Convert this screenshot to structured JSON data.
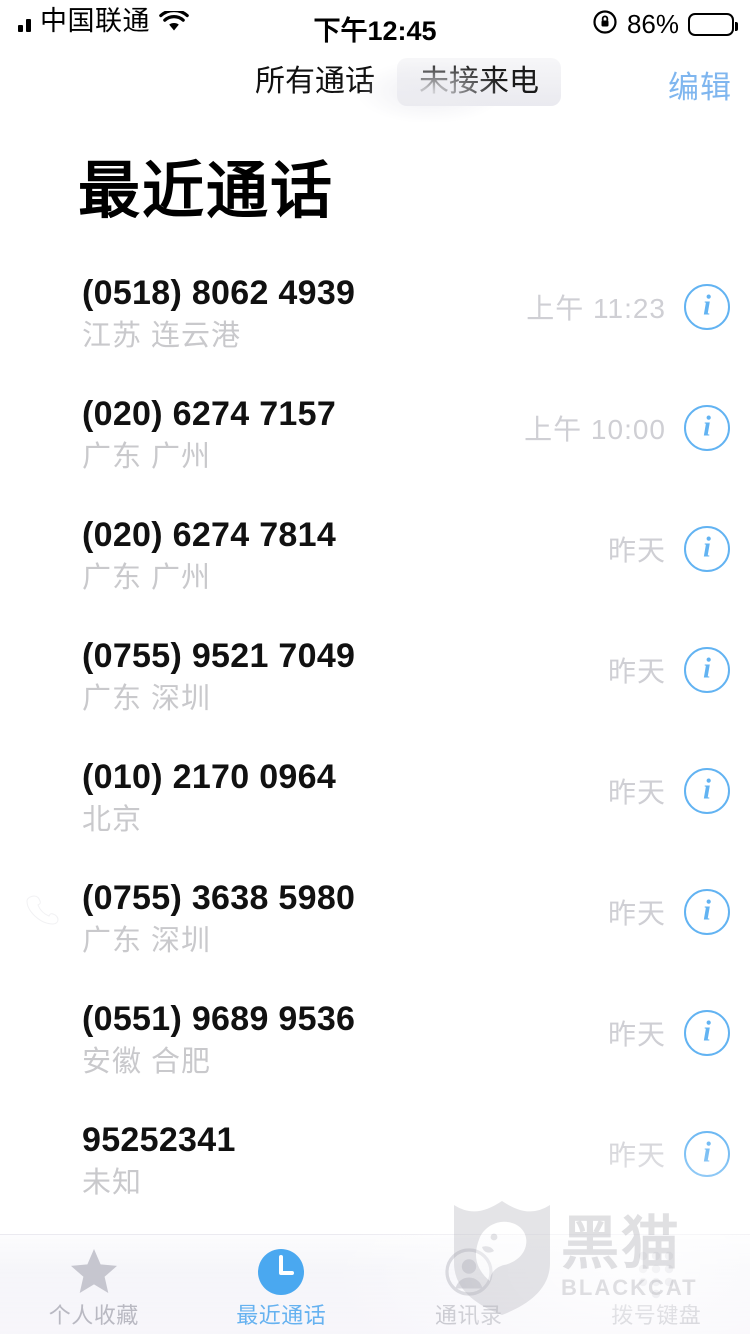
{
  "status_bar": {
    "carrier": "中国联通",
    "signal_icon": "signal-bars-icon",
    "wifi_icon": "wifi-icon",
    "time": "下午12:45",
    "rotation_lock_icon": "rotation-lock-icon",
    "battery_percent": "86%",
    "battery_icon": "battery-icon",
    "battery_level": 86
  },
  "navbar": {
    "segments": [
      {
        "label": "所有通话",
        "selected": true
      },
      {
        "label": "未接来电",
        "selected": false
      }
    ],
    "edit_label": "编辑"
  },
  "page_title": "最近通话",
  "calls": [
    {
      "number": "(0518) 8062 4939",
      "location": "江苏 连云港",
      "time": "上午 11:23",
      "info_icon": "info-icon"
    },
    {
      "number": "(020) 6274 7157",
      "location": "广东 广州",
      "time": "上午 10:00",
      "info_icon": "info-icon"
    },
    {
      "number": "(020) 6274 7814",
      "location": "广东 广州",
      "time": "昨天",
      "info_icon": "info-icon"
    },
    {
      "number": "(0755) 9521 7049",
      "location": "广东 深圳",
      "time": "昨天",
      "info_icon": "info-icon"
    },
    {
      "number": "(010) 2170 0964",
      "location": "北京",
      "time": "昨天",
      "info_icon": "info-icon"
    },
    {
      "number": "(0755) 3638 5980",
      "location": "广东 深圳",
      "time": "昨天",
      "info_icon": "info-icon"
    },
    {
      "number": "(0551) 9689 9536",
      "location": "安徽 合肥",
      "time": "昨天",
      "info_icon": "info-icon"
    },
    {
      "number": "95252341",
      "location": "未知",
      "time": "昨天",
      "info_icon": "info-icon"
    }
  ],
  "tabbar": {
    "tabs": [
      {
        "label": "个人收藏",
        "icon": "star-icon",
        "active": false
      },
      {
        "label": "最近通话",
        "icon": "clock-icon",
        "active": true
      },
      {
        "label": "通讯录",
        "icon": "person-circle-icon",
        "active": false
      },
      {
        "label": "拨号键盘",
        "icon": "keypad-icon",
        "active": false
      }
    ]
  },
  "watermark": {
    "chinese": "黑猫",
    "english": "BLACKCAT",
    "logo_icon": "blackcat-shield-icon"
  },
  "colors": {
    "accent_blue": "#62b3f2",
    "edit_blue": "#7fb6ef",
    "secondary_text": "#c9c9cc",
    "primary_text": "#111111",
    "background": "#ffffff"
  }
}
